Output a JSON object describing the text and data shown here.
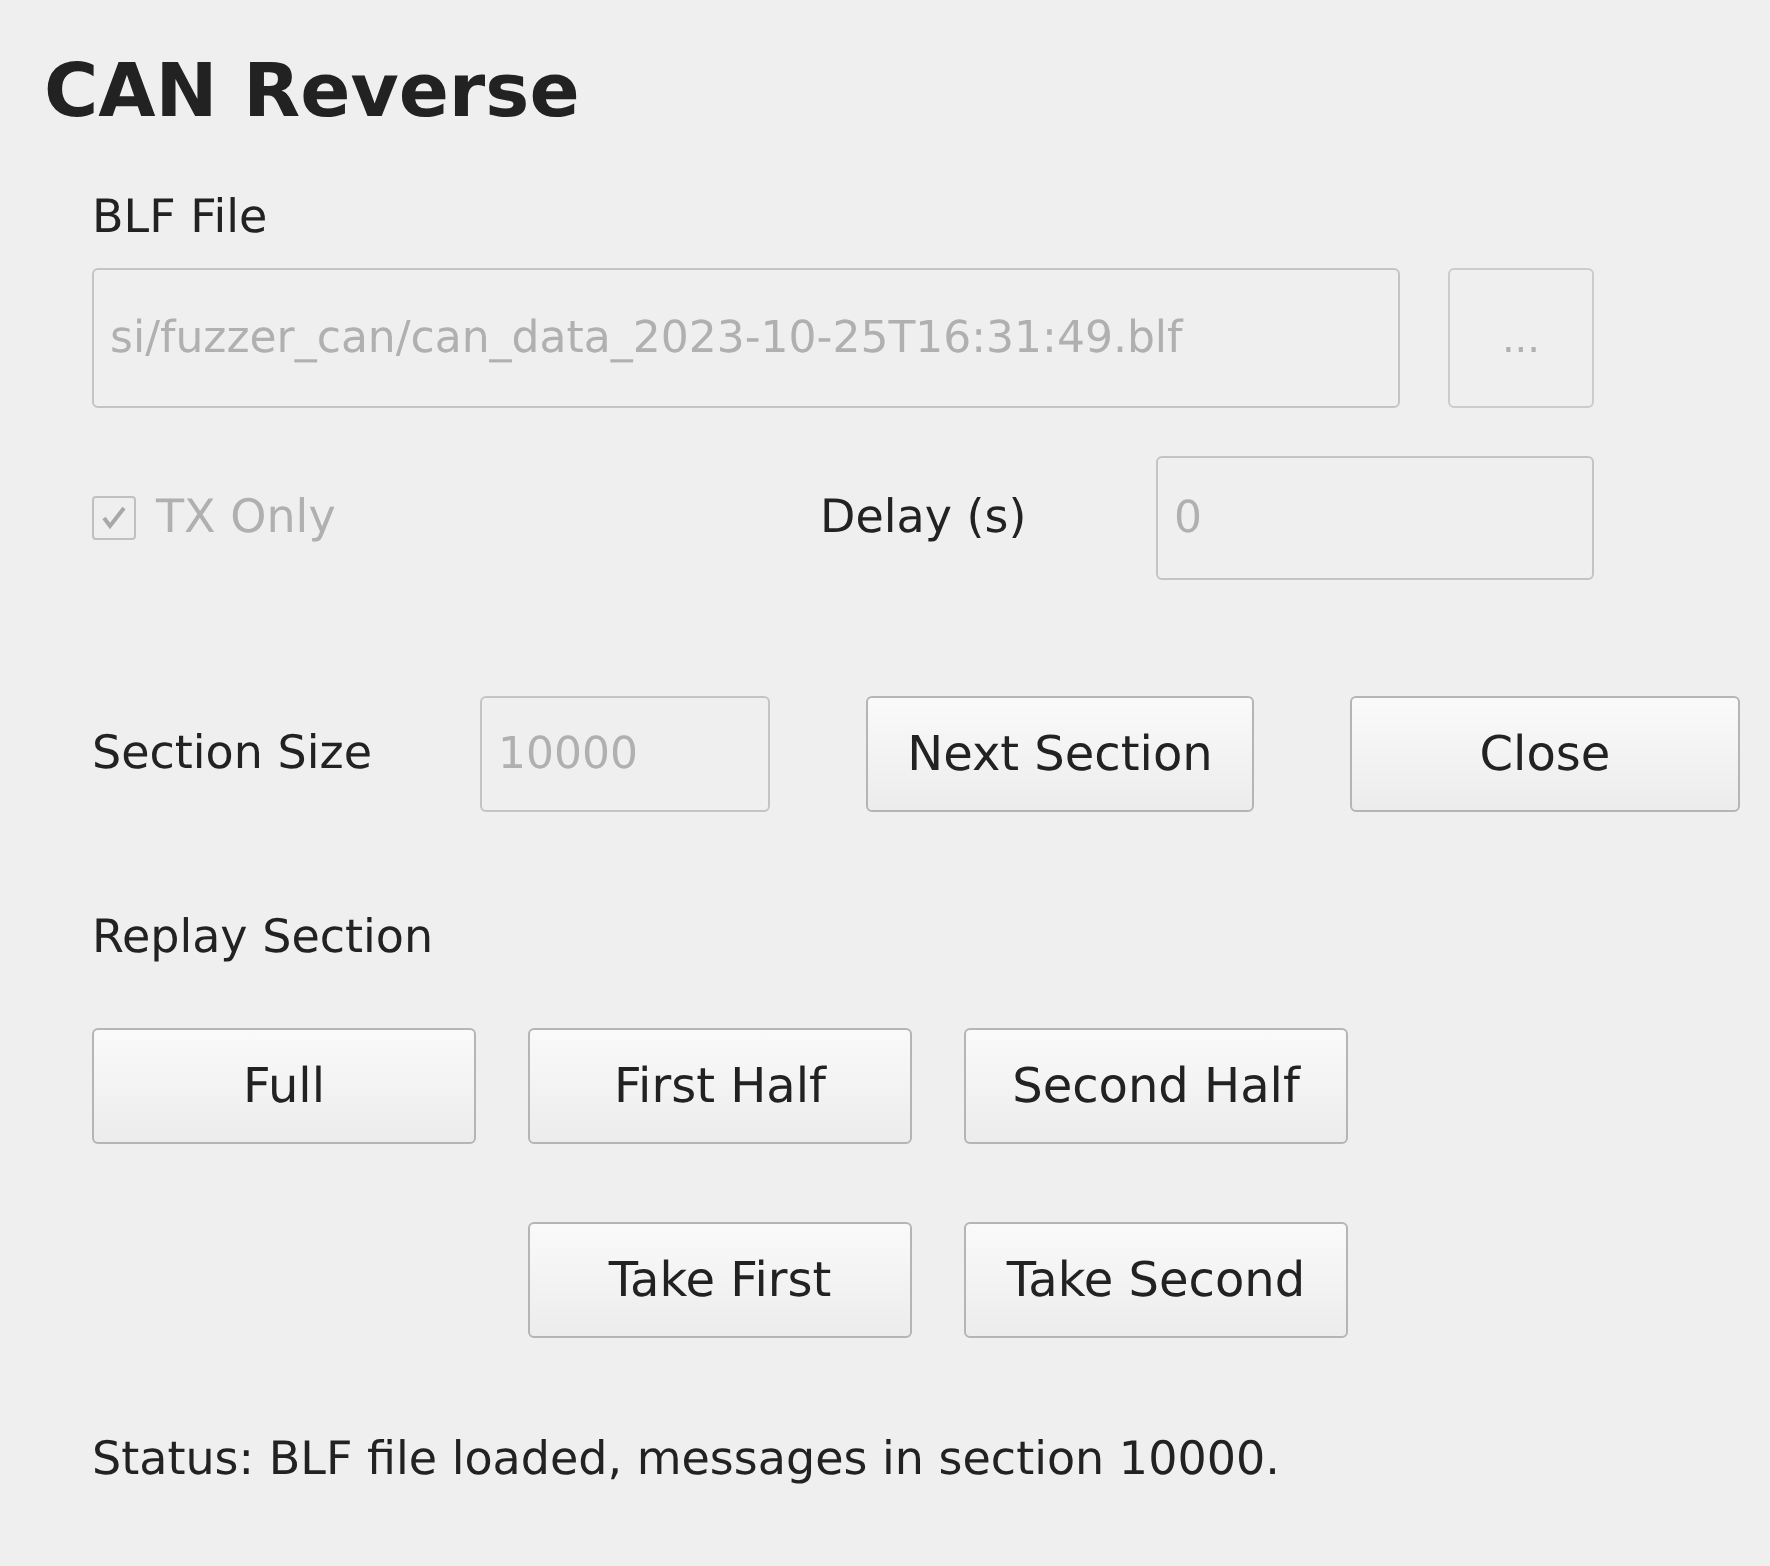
{
  "title": "CAN Reverse",
  "blf_file": {
    "label": "BLF File",
    "value": "si/fuzzer_can/can_data_2023-10-25T16:31:49.blf",
    "disabled": true
  },
  "browse_button": {
    "label": "...",
    "disabled": true
  },
  "tx_only": {
    "label": "TX Only",
    "checked": true,
    "disabled": true
  },
  "delay": {
    "label": "Delay (s)",
    "value": "0",
    "disabled": true
  },
  "section_size": {
    "label": "Section Size",
    "value": "10000",
    "disabled": true
  },
  "section_buttons": [
    {
      "label": "Next Section"
    },
    {
      "label": "Close"
    }
  ],
  "replay": {
    "label": "Replay Section",
    "buttons": [
      {
        "label": "Full"
      },
      {
        "label": "First Half"
      },
      {
        "label": "Second Half"
      }
    ],
    "take_buttons": [
      {
        "label": "Take First"
      },
      {
        "label": "Take Second"
      }
    ]
  },
  "status": "Status: BLF file loaded, messages in section 10000."
}
